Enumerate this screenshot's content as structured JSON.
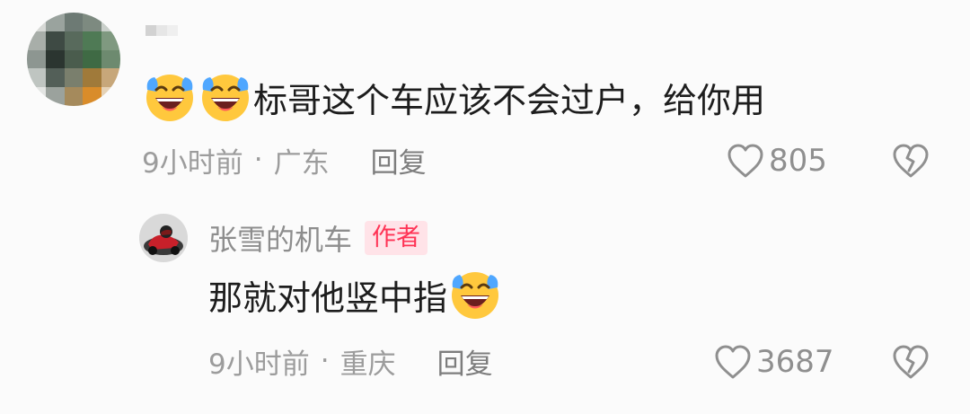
{
  "comment": {
    "text": "标哥这个车应该不会过户，给你用",
    "emoji_icon": "laugh-cry-emoji",
    "time": "9小时前",
    "separator": "·",
    "location": "广东",
    "reply_label": "回复",
    "like_count": "805"
  },
  "reply": {
    "username": "张雪的机车",
    "author_badge": "作者",
    "text": "那就对他竖中指",
    "emoji_icon": "laugh-cry-emoji",
    "time": "9小时前",
    "separator": "·",
    "location": "重庆",
    "reply_label": "回复",
    "like_count": "3687"
  },
  "colors": {
    "author_badge_text": "#ff3355",
    "author_badge_bg": "#ffe3e8",
    "meta_text": "#9c9c9c",
    "body_text": "#1d1d1d"
  }
}
